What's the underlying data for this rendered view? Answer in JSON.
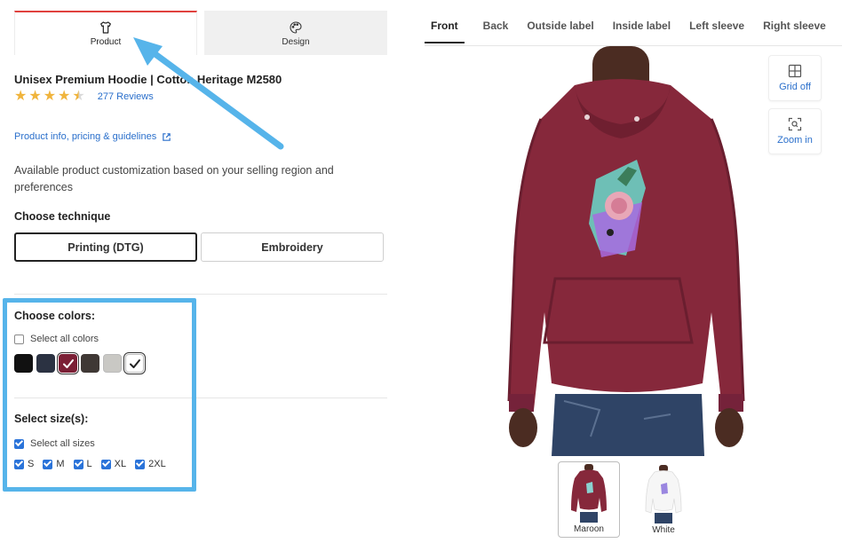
{
  "tabs": {
    "product_label": "Product",
    "design_label": "Design"
  },
  "product": {
    "title": "Unisex Premium Hoodie | Cotton Heritage M2580",
    "rating": 4.5,
    "reviews": "277 Reviews",
    "info_link": "Product info, pricing & guidelines",
    "description": "Available product customization based on your selling region and preferences"
  },
  "technique": {
    "heading": "Choose technique",
    "options": [
      "Printing (DTG)",
      "Embroidery"
    ],
    "selected": "Printing (DTG)"
  },
  "colors": {
    "heading": "Choose colors:",
    "select_all_label": "Select all colors",
    "select_all_checked": false,
    "swatches": [
      {
        "name": "black",
        "hex": "#111111",
        "selected": false
      },
      {
        "name": "navy",
        "hex": "#2b3242",
        "selected": false
      },
      {
        "name": "maroon",
        "hex": "#7b1f35",
        "selected": true
      },
      {
        "name": "brown",
        "hex": "#3f3835",
        "selected": false
      },
      {
        "name": "grey",
        "hex": "#c9c8c4",
        "selected": false
      },
      {
        "name": "white",
        "hex": "#ffffff",
        "selected": true
      }
    ]
  },
  "sizes": {
    "heading": "Select size(s):",
    "select_all_label": "Select all sizes",
    "select_all_checked": true,
    "options": [
      "S",
      "M",
      "L",
      "XL",
      "2XL"
    ]
  },
  "views": {
    "tabs": [
      "Front",
      "Back",
      "Outside label",
      "Inside label",
      "Left sleeve",
      "Right sleeve"
    ],
    "active": "Front"
  },
  "tools": {
    "grid_label": "Grid off",
    "zoom_label": "Zoom in"
  },
  "thumbnails": [
    {
      "label": "Maroon",
      "active": true
    },
    {
      "label": "White",
      "active": false
    }
  ],
  "theme": {
    "accent_red": "#e0413e",
    "link_blue": "#2a6fcb",
    "annotation_blue": "#56b4ea",
    "hoodie_maroon": "#86283b"
  }
}
